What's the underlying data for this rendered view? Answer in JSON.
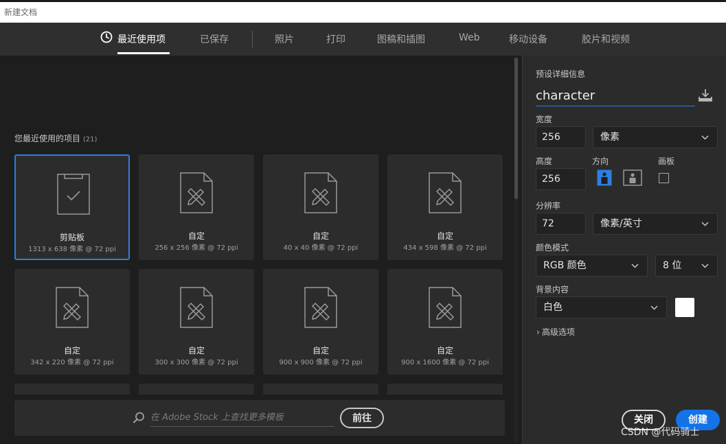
{
  "window": {
    "title": "新建文档"
  },
  "tabs": [
    {
      "label": "最近使用项",
      "active": true,
      "icon": "clock-icon"
    },
    {
      "label": "已保存"
    },
    {
      "label": "照片"
    },
    {
      "label": "打印"
    },
    {
      "label": "图稿和插图"
    },
    {
      "label": "Web"
    },
    {
      "label": "移动设备"
    },
    {
      "label": "胶片和视频"
    }
  ],
  "recent": {
    "title": "您最近使用的项目",
    "count": "(21)",
    "items": [
      {
        "name": "剪贴板",
        "dims": "1313 x 638 像素 @ 72 ppi",
        "icon": "clipboard-icon",
        "selected": true
      },
      {
        "name": "自定",
        "dims": "256 x 256 像素 @ 72 ppi",
        "icon": "custom-doc-icon"
      },
      {
        "name": "自定",
        "dims": "40 x 40 像素 @ 72 ppi",
        "icon": "custom-doc-icon"
      },
      {
        "name": "自定",
        "dims": "434 x 598 像素 @ 72 ppi",
        "icon": "custom-doc-icon"
      },
      {
        "name": "自定",
        "dims": "342 x 220 像素 @ 72 ppi",
        "icon": "custom-doc-icon"
      },
      {
        "name": "自定",
        "dims": "300 x 300 像素 @ 72 ppi",
        "icon": "custom-doc-icon"
      },
      {
        "name": "自定",
        "dims": "900 x 900 像素 @ 72 ppi",
        "icon": "custom-doc-icon"
      },
      {
        "name": "自定",
        "dims": "900 x 1600 像素 @ 72 ppi",
        "icon": "custom-doc-icon"
      }
    ]
  },
  "stock": {
    "placeholder": "在 Adobe Stock 上查找更多模板",
    "go_label": "前往"
  },
  "preset": {
    "section_label": "预设详细信息",
    "name": "character",
    "width_label": "宽度",
    "width_value": "256",
    "width_unit": "像素",
    "height_label": "高度",
    "height_value": "256",
    "orientation_label": "方向",
    "artboard_label": "画板",
    "resolution_label": "分辨率",
    "resolution_value": "72",
    "resolution_unit": "像素/英寸",
    "color_mode_label": "颜色模式",
    "color_mode": "RGB 颜色",
    "bit_depth": "8 位",
    "background_label": "背景内容",
    "background": "白色",
    "background_color": "#ffffff",
    "advanced_label": "高级选项"
  },
  "actions": {
    "close_label": "关闭",
    "create_label": "创建"
  },
  "watermark": "CSDN @代码骑士",
  "colors": {
    "accent": "#1473e6",
    "selection": "#2f7ee0"
  }
}
